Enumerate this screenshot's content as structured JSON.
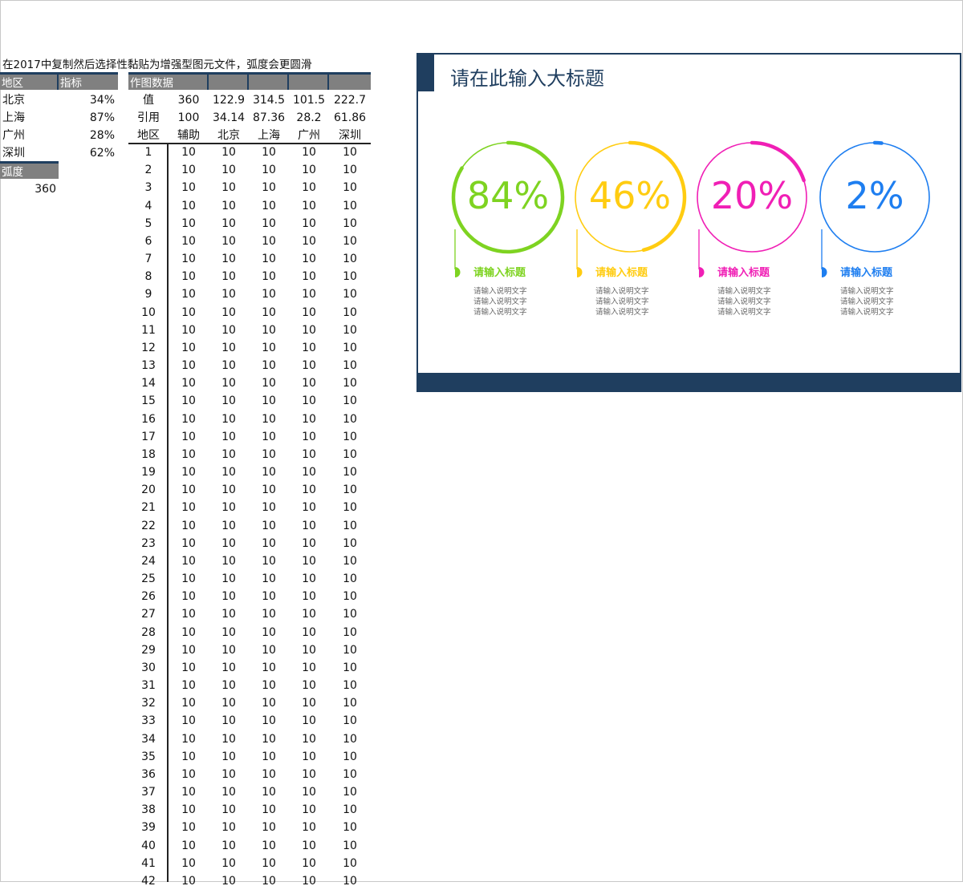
{
  "note": "在2017中复制然后选择性黏贴为增强型图元文件，弧度会更圆滑",
  "left_table": {
    "headers": [
      "地区",
      "指标"
    ],
    "rows": [
      {
        "region": "北京",
        "value": "34%"
      },
      {
        "region": "上海",
        "value": "87%"
      },
      {
        "region": "广州",
        "value": "28%"
      },
      {
        "region": "深圳",
        "value": "62%"
      }
    ],
    "arc_label": "弧度",
    "arc_value": "360"
  },
  "right_table": {
    "header": "作图数据",
    "value_row": [
      "值",
      "360",
      "122.9",
      "314.5",
      "101.5",
      "222.7"
    ],
    "ref_row": [
      "引用",
      "100",
      "34.14",
      "87.36",
      "28.2",
      "61.86"
    ],
    "col_row": [
      "地区",
      "辅助",
      "北京",
      "上海",
      "广州",
      "深圳"
    ],
    "row_count": 42,
    "cell_value": "10"
  },
  "chart": {
    "title": "请在此输入大标题",
    "accent": "#1f3e5f",
    "items": [
      {
        "pct": "84%",
        "frac": 0.84,
        "color": "#7ed321",
        "caption": "请输入标题",
        "desc": [
          "请输入说明文字",
          "请输入说明文字",
          "请输入说明文字"
        ]
      },
      {
        "pct": "46%",
        "frac": 0.46,
        "color": "#ffcc11",
        "caption": "请输入标题",
        "desc": [
          "请输入说明文字",
          "请输入说明文字",
          "请输入说明文字"
        ]
      },
      {
        "pct": "20%",
        "frac": 0.2,
        "color": "#f01fb5",
        "caption": "请输入标题",
        "desc": [
          "请输入说明文字",
          "请输入说明文字",
          "请输入说明文字"
        ]
      },
      {
        "pct": "2%",
        "frac": 0.02,
        "color": "#1e7ef0",
        "caption": "请输入标题",
        "desc": [
          "请输入说明文字",
          "请输入说明文字",
          "请输入说明文字"
        ]
      }
    ]
  }
}
